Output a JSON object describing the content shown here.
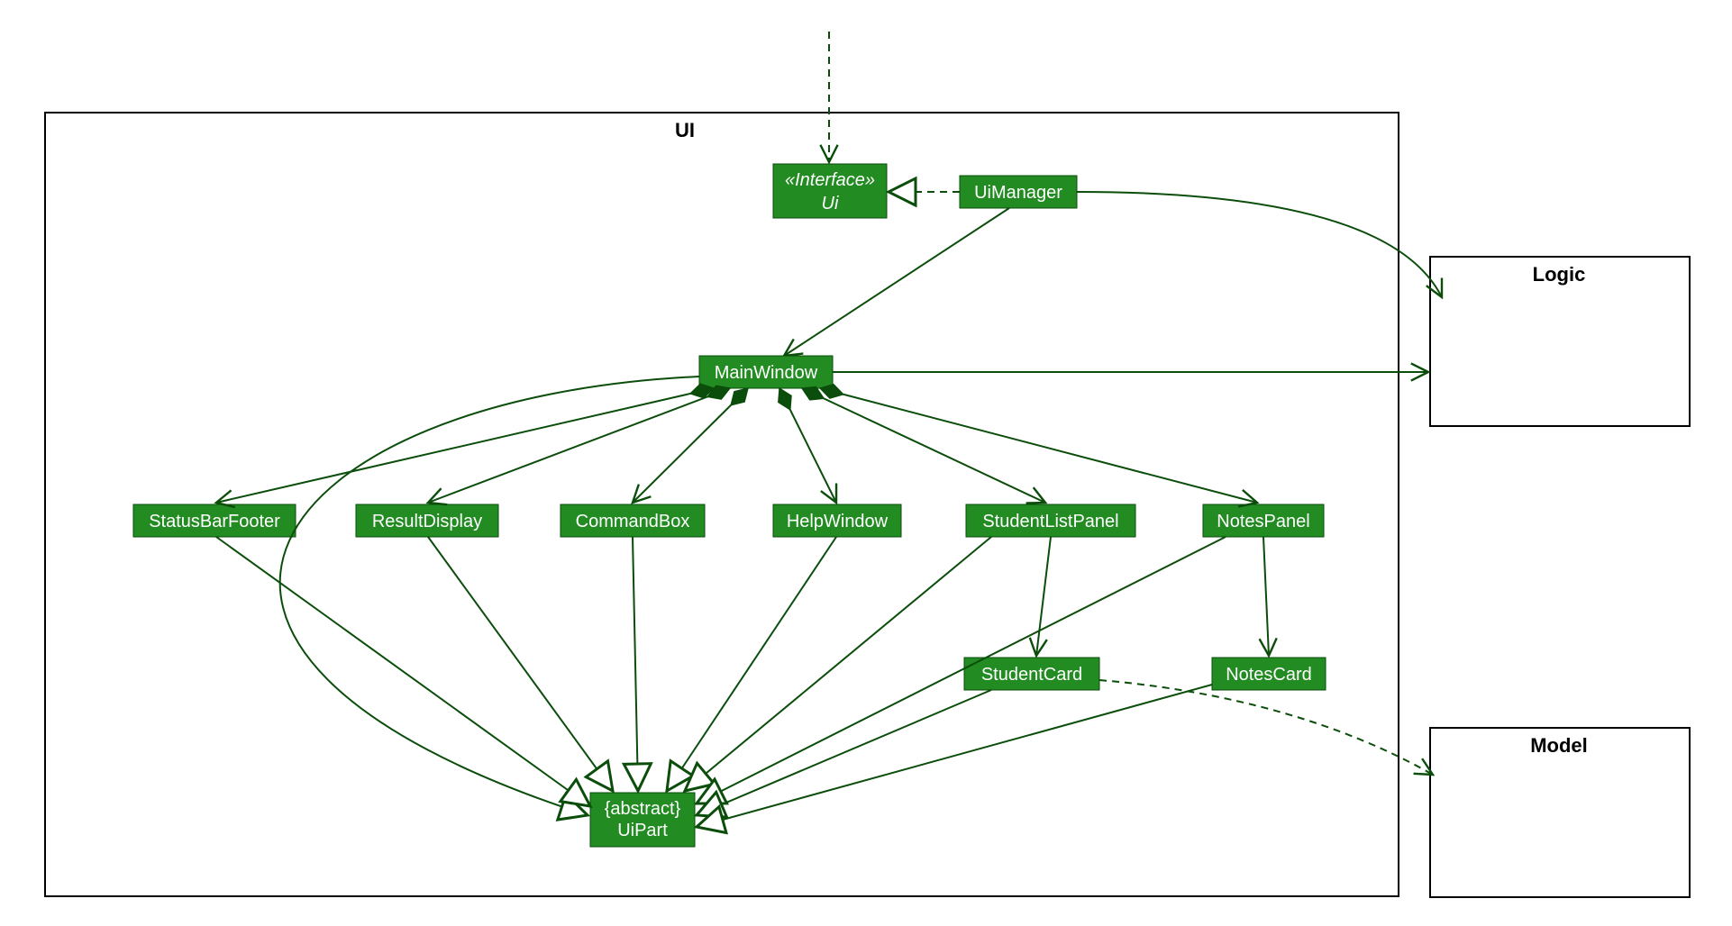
{
  "packages": {
    "ui": "UI",
    "logic": "Logic",
    "model": "Model"
  },
  "classes": {
    "ui_interface": {
      "stereotype": "«Interface»",
      "name": "Ui"
    },
    "ui_manager": {
      "name": "UiManager"
    },
    "main_window": {
      "name": "MainWindow"
    },
    "status_bar_footer": {
      "name": "StatusBarFooter"
    },
    "result_display": {
      "name": "ResultDisplay"
    },
    "command_box": {
      "name": "CommandBox"
    },
    "help_window": {
      "name": "HelpWindow"
    },
    "student_list_panel": {
      "name": "StudentListPanel"
    },
    "notes_panel": {
      "name": "NotesPanel"
    },
    "student_card": {
      "name": "StudentCard"
    },
    "notes_card": {
      "name": "NotesCard"
    },
    "ui_part": {
      "stereotype": "{abstract}",
      "name": "UiPart"
    }
  },
  "colors": {
    "class_fill": "#228B22",
    "class_stroke": "#0b4d0b",
    "edge": "#0b4d0b"
  },
  "relationships": [
    {
      "from": "external-top",
      "to": "Ui",
      "type": "dependency-dashed"
    },
    {
      "from": "UiManager",
      "to": "Ui",
      "type": "realization"
    },
    {
      "from": "UiManager",
      "to": "MainWindow",
      "type": "association"
    },
    {
      "from": "UiManager",
      "to": "Logic",
      "type": "association-curved"
    },
    {
      "from": "MainWindow",
      "to": "Logic",
      "type": "association"
    },
    {
      "from": "MainWindow",
      "to": "StatusBarFooter",
      "type": "composition"
    },
    {
      "from": "MainWindow",
      "to": "ResultDisplay",
      "type": "composition"
    },
    {
      "from": "MainWindow",
      "to": "CommandBox",
      "type": "composition"
    },
    {
      "from": "MainWindow",
      "to": "HelpWindow",
      "type": "composition"
    },
    {
      "from": "MainWindow",
      "to": "StudentListPanel",
      "type": "composition"
    },
    {
      "from": "MainWindow",
      "to": "NotesPanel",
      "type": "composition"
    },
    {
      "from": "StudentListPanel",
      "to": "StudentCard",
      "type": "association"
    },
    {
      "from": "NotesPanel",
      "to": "NotesCard",
      "type": "association"
    },
    {
      "from": "MainWindow",
      "to": "UiPart",
      "type": "generalization-curved"
    },
    {
      "from": "StatusBarFooter",
      "to": "UiPart",
      "type": "generalization"
    },
    {
      "from": "ResultDisplay",
      "to": "UiPart",
      "type": "generalization"
    },
    {
      "from": "CommandBox",
      "to": "UiPart",
      "type": "generalization"
    },
    {
      "from": "HelpWindow",
      "to": "UiPart",
      "type": "generalization"
    },
    {
      "from": "StudentListPanel",
      "to": "UiPart",
      "type": "generalization"
    },
    {
      "from": "NotesPanel",
      "to": "UiPart",
      "type": "generalization"
    },
    {
      "from": "StudentCard",
      "to": "UiPart",
      "type": "generalization"
    },
    {
      "from": "NotesCard",
      "to": "UiPart",
      "type": "generalization"
    },
    {
      "from": "StudentCard",
      "to": "Model",
      "type": "dependency-dashed-curved"
    }
  ]
}
